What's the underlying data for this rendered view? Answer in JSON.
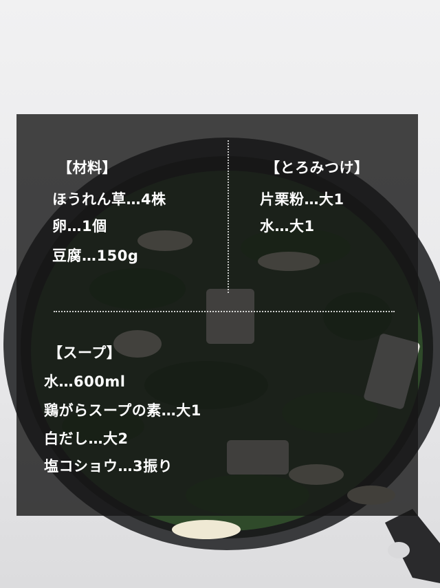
{
  "recipe": {
    "ingredients": {
      "heading": "【材料】",
      "items": [
        "ほうれん草…4株",
        "卵…1個",
        "豆腐…150g"
      ]
    },
    "thickening": {
      "heading": "【とろみつけ】",
      "items": [
        "片栗粉…大1",
        "水…大1"
      ]
    },
    "soup": {
      "heading": "【スープ】",
      "items": [
        "水…600ml",
        "鶏がらスープの素…大1",
        "白だし…大2",
        "塩コショウ…3振り"
      ]
    }
  },
  "colors": {
    "overlay": "#161616",
    "text": "#ffffff",
    "pan": "#2b2c2e",
    "spinach": "#1f4a1a"
  }
}
